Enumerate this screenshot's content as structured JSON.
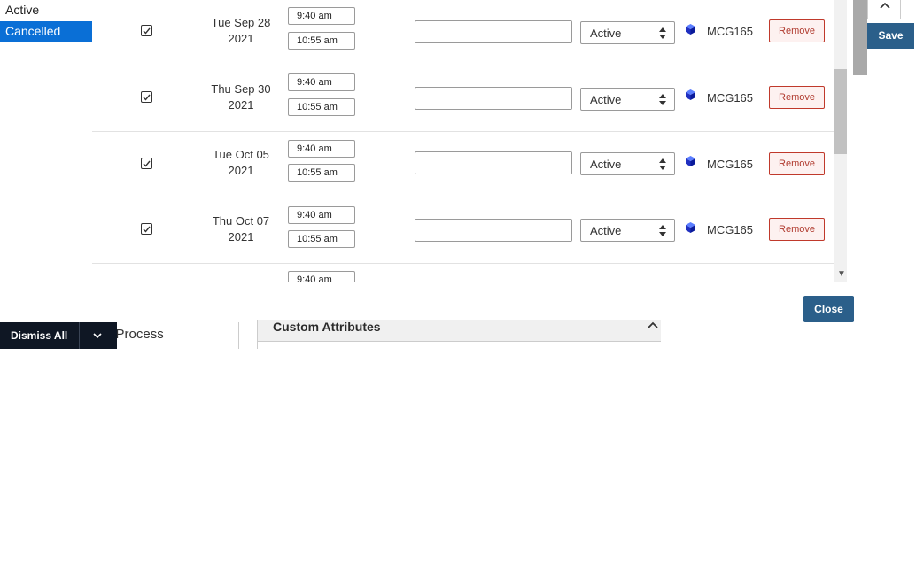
{
  "status_options": [
    "Active",
    "Cancelled"
  ],
  "status_selected": "Cancelled",
  "occurrences": [
    {
      "date_line1": "Tue Sep 28",
      "date_line2": "2021",
      "start": "9:40 am",
      "end": "10:55 am",
      "state": "Active",
      "room": "MCG165",
      "remove": "Remove"
    },
    {
      "date_line1": "Thu Sep 30",
      "date_line2": "2021",
      "start": "9:40 am",
      "end": "10:55 am",
      "state": "Active",
      "room": "MCG165",
      "remove": "Remove"
    },
    {
      "date_line1": "Tue Oct 05",
      "date_line2": "2021",
      "start": "9:40 am",
      "end": "10:55 am",
      "state": "Active",
      "room": "MCG165",
      "remove": "Remove"
    },
    {
      "date_line1": "Thu Oct 07",
      "date_line2": "2021",
      "start": "9:40 am",
      "end": "10:55 am",
      "state": "Active",
      "room": "MCG165",
      "remove": "Remove"
    }
  ],
  "partial_row_start": "9:40 am",
  "buttons": {
    "save": "Save",
    "close": "Close",
    "dismiss_all": "Dismiss All"
  },
  "background": {
    "process_label": "e Process",
    "custom_attributes": "Custom Attributes"
  },
  "colors": {
    "primary_button": "#2b5f8a",
    "selected_option": "#0a6fd6",
    "remove_text": "#b03a2e",
    "toast_bg": "#0f1724"
  },
  "icons": {
    "cube": "location-cube-icon",
    "collapse": "chevron-up-icon",
    "dropdown": "chevron-down-icon"
  }
}
